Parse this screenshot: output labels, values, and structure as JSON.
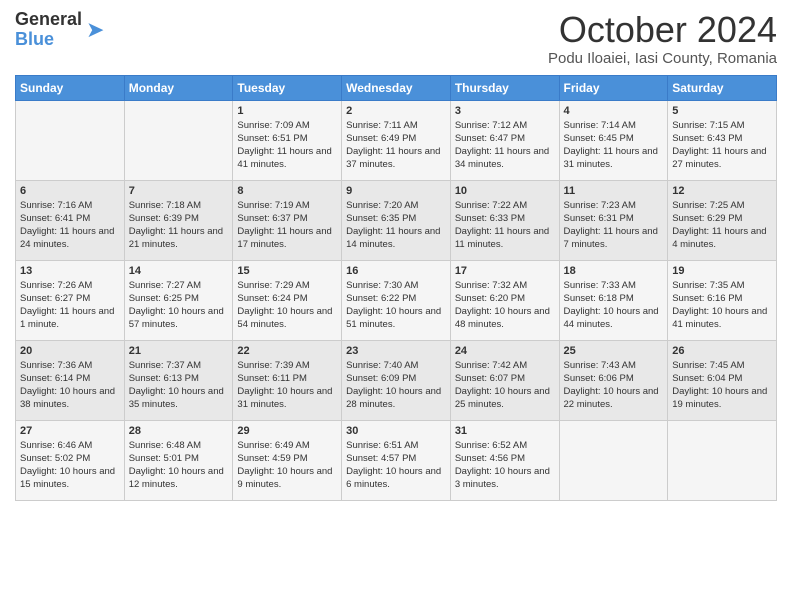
{
  "header": {
    "logo_general": "General",
    "logo_blue": "Blue",
    "month_title": "October 2024",
    "location": "Podu Iloaiei, Iasi County, Romania"
  },
  "days_of_week": [
    "Sunday",
    "Monday",
    "Tuesday",
    "Wednesday",
    "Thursday",
    "Friday",
    "Saturday"
  ],
  "weeks": [
    [
      {
        "day": "",
        "sunrise": "",
        "sunset": "",
        "daylight": ""
      },
      {
        "day": "",
        "sunrise": "",
        "sunset": "",
        "daylight": ""
      },
      {
        "day": "1",
        "sunrise": "Sunrise: 7:09 AM",
        "sunset": "Sunset: 6:51 PM",
        "daylight": "Daylight: 11 hours and 41 minutes."
      },
      {
        "day": "2",
        "sunrise": "Sunrise: 7:11 AM",
        "sunset": "Sunset: 6:49 PM",
        "daylight": "Daylight: 11 hours and 37 minutes."
      },
      {
        "day": "3",
        "sunrise": "Sunrise: 7:12 AM",
        "sunset": "Sunset: 6:47 PM",
        "daylight": "Daylight: 11 hours and 34 minutes."
      },
      {
        "day": "4",
        "sunrise": "Sunrise: 7:14 AM",
        "sunset": "Sunset: 6:45 PM",
        "daylight": "Daylight: 11 hours and 31 minutes."
      },
      {
        "day": "5",
        "sunrise": "Sunrise: 7:15 AM",
        "sunset": "Sunset: 6:43 PM",
        "daylight": "Daylight: 11 hours and 27 minutes."
      }
    ],
    [
      {
        "day": "6",
        "sunrise": "Sunrise: 7:16 AM",
        "sunset": "Sunset: 6:41 PM",
        "daylight": "Daylight: 11 hours and 24 minutes."
      },
      {
        "day": "7",
        "sunrise": "Sunrise: 7:18 AM",
        "sunset": "Sunset: 6:39 PM",
        "daylight": "Daylight: 11 hours and 21 minutes."
      },
      {
        "day": "8",
        "sunrise": "Sunrise: 7:19 AM",
        "sunset": "Sunset: 6:37 PM",
        "daylight": "Daylight: 11 hours and 17 minutes."
      },
      {
        "day": "9",
        "sunrise": "Sunrise: 7:20 AM",
        "sunset": "Sunset: 6:35 PM",
        "daylight": "Daylight: 11 hours and 14 minutes."
      },
      {
        "day": "10",
        "sunrise": "Sunrise: 7:22 AM",
        "sunset": "Sunset: 6:33 PM",
        "daylight": "Daylight: 11 hours and 11 minutes."
      },
      {
        "day": "11",
        "sunrise": "Sunrise: 7:23 AM",
        "sunset": "Sunset: 6:31 PM",
        "daylight": "Daylight: 11 hours and 7 minutes."
      },
      {
        "day": "12",
        "sunrise": "Sunrise: 7:25 AM",
        "sunset": "Sunset: 6:29 PM",
        "daylight": "Daylight: 11 hours and 4 minutes."
      }
    ],
    [
      {
        "day": "13",
        "sunrise": "Sunrise: 7:26 AM",
        "sunset": "Sunset: 6:27 PM",
        "daylight": "Daylight: 11 hours and 1 minute."
      },
      {
        "day": "14",
        "sunrise": "Sunrise: 7:27 AM",
        "sunset": "Sunset: 6:25 PM",
        "daylight": "Daylight: 10 hours and 57 minutes."
      },
      {
        "day": "15",
        "sunrise": "Sunrise: 7:29 AM",
        "sunset": "Sunset: 6:24 PM",
        "daylight": "Daylight: 10 hours and 54 minutes."
      },
      {
        "day": "16",
        "sunrise": "Sunrise: 7:30 AM",
        "sunset": "Sunset: 6:22 PM",
        "daylight": "Daylight: 10 hours and 51 minutes."
      },
      {
        "day": "17",
        "sunrise": "Sunrise: 7:32 AM",
        "sunset": "Sunset: 6:20 PM",
        "daylight": "Daylight: 10 hours and 48 minutes."
      },
      {
        "day": "18",
        "sunrise": "Sunrise: 7:33 AM",
        "sunset": "Sunset: 6:18 PM",
        "daylight": "Daylight: 10 hours and 44 minutes."
      },
      {
        "day": "19",
        "sunrise": "Sunrise: 7:35 AM",
        "sunset": "Sunset: 6:16 PM",
        "daylight": "Daylight: 10 hours and 41 minutes."
      }
    ],
    [
      {
        "day": "20",
        "sunrise": "Sunrise: 7:36 AM",
        "sunset": "Sunset: 6:14 PM",
        "daylight": "Daylight: 10 hours and 38 minutes."
      },
      {
        "day": "21",
        "sunrise": "Sunrise: 7:37 AM",
        "sunset": "Sunset: 6:13 PM",
        "daylight": "Daylight: 10 hours and 35 minutes."
      },
      {
        "day": "22",
        "sunrise": "Sunrise: 7:39 AM",
        "sunset": "Sunset: 6:11 PM",
        "daylight": "Daylight: 10 hours and 31 minutes."
      },
      {
        "day": "23",
        "sunrise": "Sunrise: 7:40 AM",
        "sunset": "Sunset: 6:09 PM",
        "daylight": "Daylight: 10 hours and 28 minutes."
      },
      {
        "day": "24",
        "sunrise": "Sunrise: 7:42 AM",
        "sunset": "Sunset: 6:07 PM",
        "daylight": "Daylight: 10 hours and 25 minutes."
      },
      {
        "day": "25",
        "sunrise": "Sunrise: 7:43 AM",
        "sunset": "Sunset: 6:06 PM",
        "daylight": "Daylight: 10 hours and 22 minutes."
      },
      {
        "day": "26",
        "sunrise": "Sunrise: 7:45 AM",
        "sunset": "Sunset: 6:04 PM",
        "daylight": "Daylight: 10 hours and 19 minutes."
      }
    ],
    [
      {
        "day": "27",
        "sunrise": "Sunrise: 6:46 AM",
        "sunset": "Sunset: 5:02 PM",
        "daylight": "Daylight: 10 hours and 15 minutes."
      },
      {
        "day": "28",
        "sunrise": "Sunrise: 6:48 AM",
        "sunset": "Sunset: 5:01 PM",
        "daylight": "Daylight: 10 hours and 12 minutes."
      },
      {
        "day": "29",
        "sunrise": "Sunrise: 6:49 AM",
        "sunset": "Sunset: 4:59 PM",
        "daylight": "Daylight: 10 hours and 9 minutes."
      },
      {
        "day": "30",
        "sunrise": "Sunrise: 6:51 AM",
        "sunset": "Sunset: 4:57 PM",
        "daylight": "Daylight: 10 hours and 6 minutes."
      },
      {
        "day": "31",
        "sunrise": "Sunrise: 6:52 AM",
        "sunset": "Sunset: 4:56 PM",
        "daylight": "Daylight: 10 hours and 3 minutes."
      },
      {
        "day": "",
        "sunrise": "",
        "sunset": "",
        "daylight": ""
      },
      {
        "day": "",
        "sunrise": "",
        "sunset": "",
        "daylight": ""
      }
    ]
  ]
}
